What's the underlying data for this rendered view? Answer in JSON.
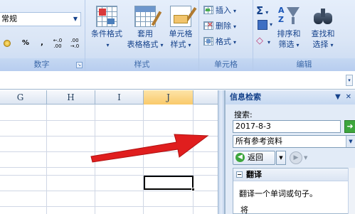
{
  "ribbon": {
    "number": {
      "format_value": "常规",
      "percent_label": "%",
      "comma_label": ",",
      "increase_decimal_label": "←.0 .00",
      "decrease_decimal_label": ".00 →.0",
      "group_label": "数字"
    },
    "styles": {
      "conditional_format": {
        "line1": "条件格式",
        "line2": ""
      },
      "table_format": {
        "line1": "套用",
        "line2": "表格格式"
      },
      "cell_styles": {
        "line1": "单元格",
        "line2": "样式"
      },
      "group_label": "样式"
    },
    "cells": {
      "insert": "插入",
      "delete": "删除",
      "format": "格式",
      "group_label": "单元格"
    },
    "editing": {
      "sigma": "Σ",
      "sort_filter": {
        "line1": "排序和",
        "line2": "筛选"
      },
      "find_select": {
        "line1": "查找和",
        "line2": "选择"
      },
      "group_label": "编辑"
    }
  },
  "sheet": {
    "columns": [
      "G",
      "H",
      "I",
      "J"
    ],
    "active_column": "J"
  },
  "research_pane": {
    "title": "信息检索",
    "search_label": "搜索:",
    "search_value": "2017-8-3",
    "source_value": "所有参考资料",
    "back_label": "返回",
    "section_title": "翻译",
    "section_text": "翻译一个单词或句子。",
    "section_more": "将"
  },
  "colors": {
    "ribbon_bg": "#dbe6f6",
    "ribbon_text": "#15428b",
    "arrow": "#e01e1e",
    "active_header": "#f9c96a",
    "go_button": "#3da63d"
  },
  "icons": {
    "currency": "currency-icon",
    "conditional_format": "conditional-format-icon",
    "table_format": "table-format-icon",
    "cell_styles": "cell-styles-icon",
    "sort_filter": "sort-filter-icon",
    "find_select": "binoculars-icon"
  }
}
